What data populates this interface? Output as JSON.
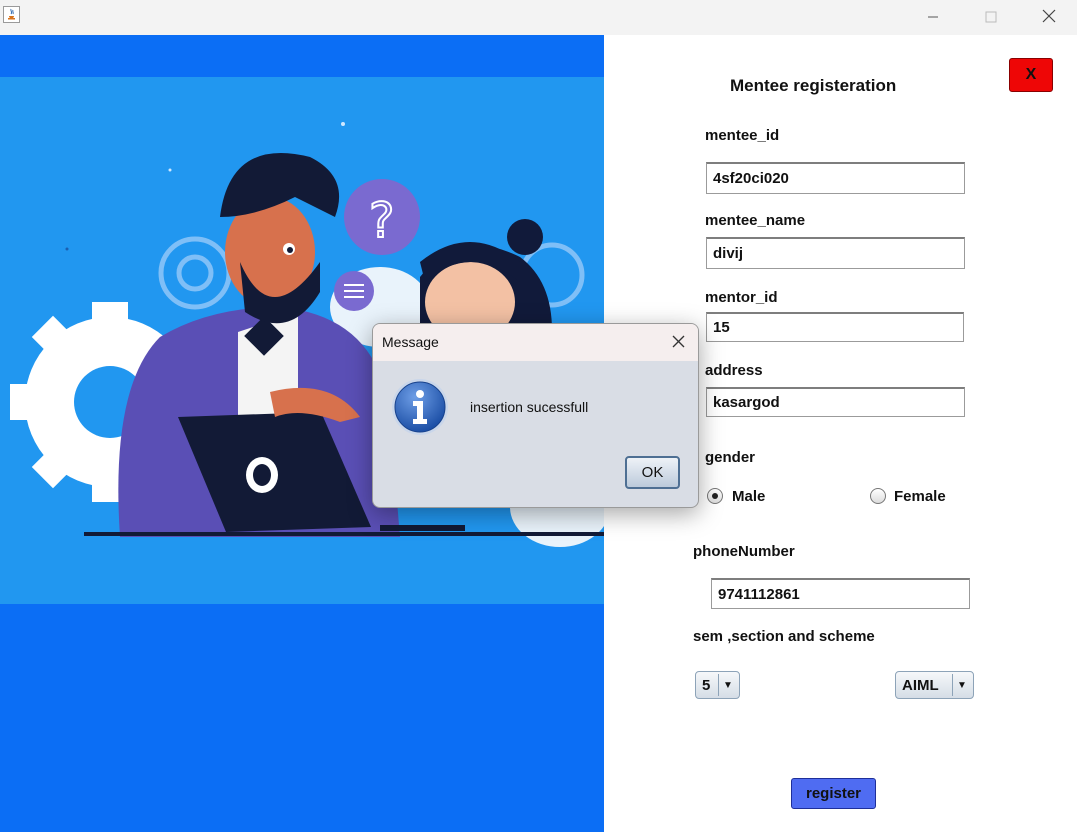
{
  "window": {
    "controls": {
      "minimize_icon": "minimize-icon",
      "maximize_icon": "maximize-icon",
      "close_icon": "close-icon"
    }
  },
  "form": {
    "title": "Mentee registeration",
    "close_label": "X",
    "mentee_id": {
      "label": "mentee_id",
      "value": "4sf20ci020"
    },
    "mentee_name": {
      "label": "mentee_name",
      "value": "divij"
    },
    "mentor_id": {
      "label": "mentor_id",
      "value": "15"
    },
    "address": {
      "label": "address",
      "value": "kasargod"
    },
    "gender": {
      "label": "gender",
      "options": [
        "Male",
        "Female"
      ],
      "selected": "Male"
    },
    "phone": {
      "label": "phoneNumber",
      "value": "9741112861"
    },
    "sem_section": {
      "label": "sem ,section and scheme",
      "sem": "5",
      "scheme": "AIML"
    },
    "register_label": "register"
  },
  "dialog": {
    "title": "Message",
    "message": "insertion sucessfull",
    "ok_label": "OK",
    "icon": "info-icon"
  },
  "colors": {
    "left_panel": "#0b6ef5",
    "illustration_bg": "#2197f0",
    "close_button": "#ee0606",
    "register_button": "#4f6cf2"
  }
}
